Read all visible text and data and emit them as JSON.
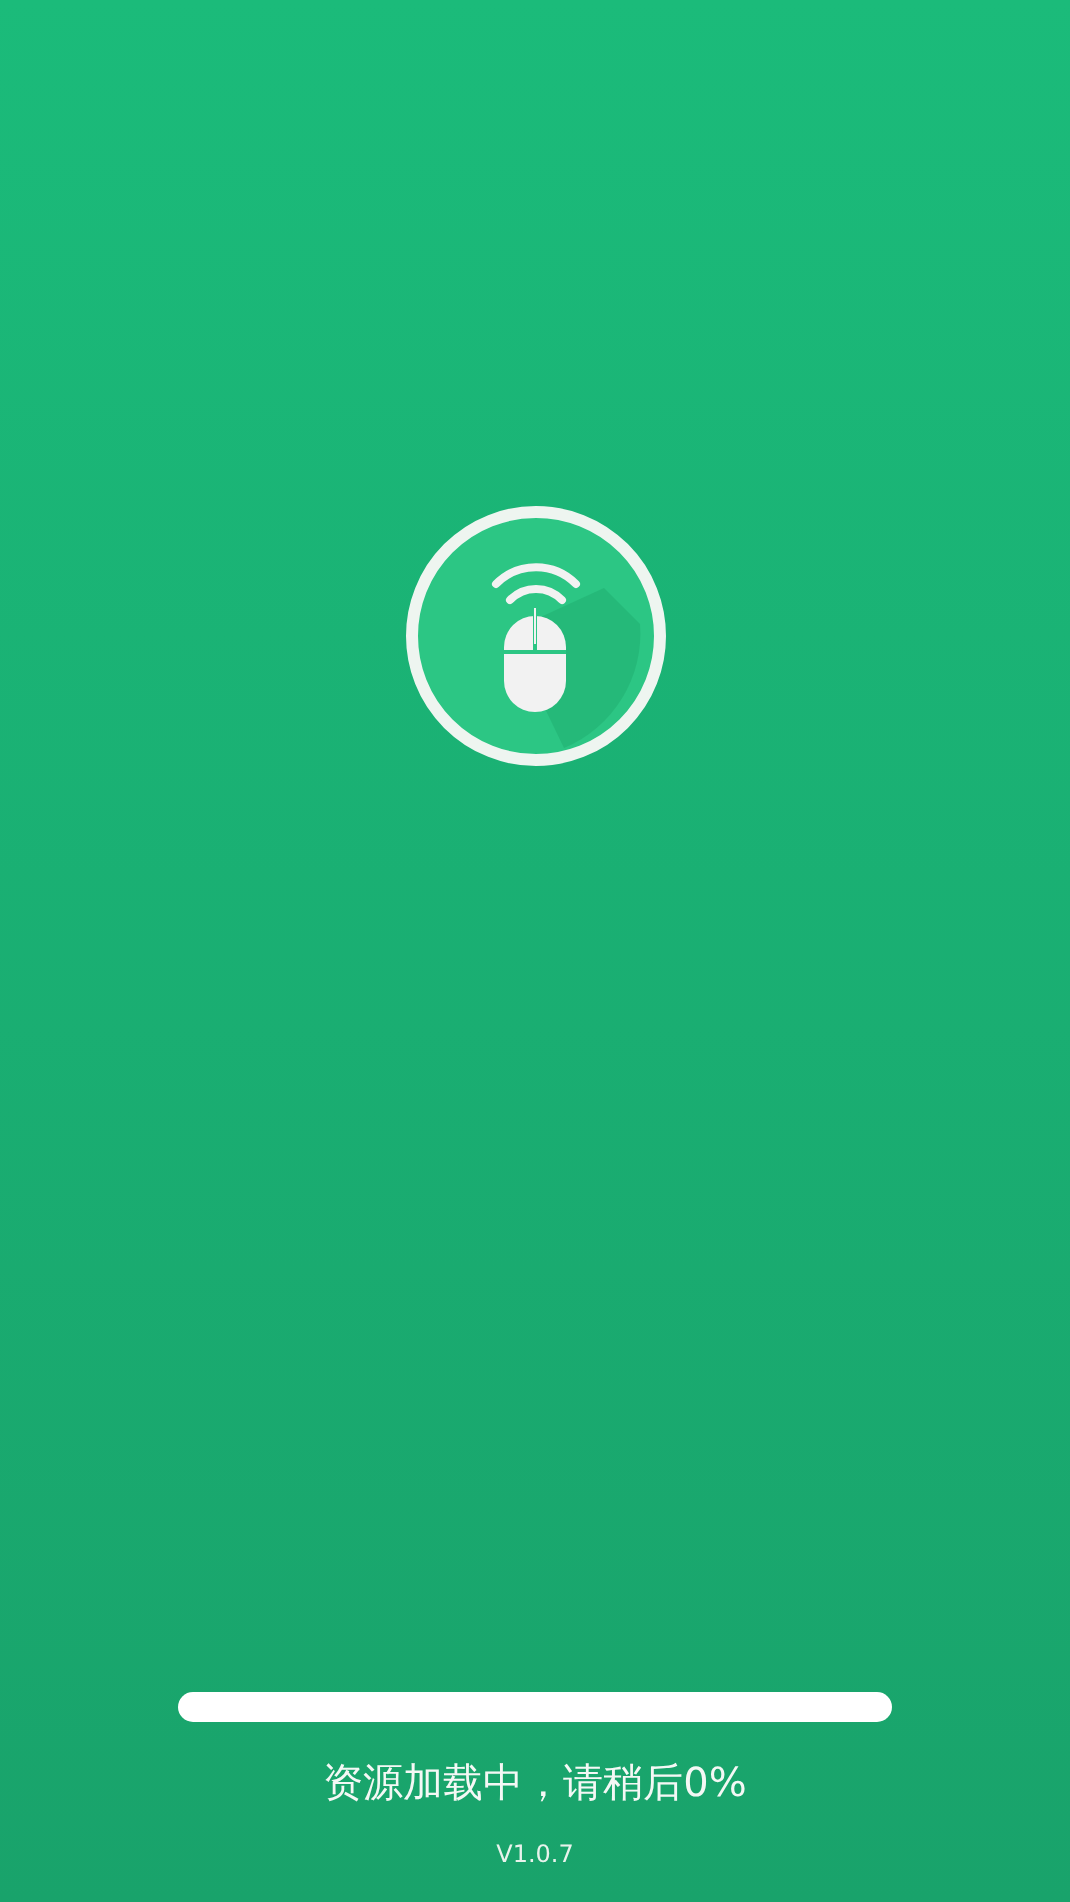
{
  "progress": {
    "level": 0
  },
  "status": "资源加载中，请稍后0%",
  "version": "V1.0.7"
}
